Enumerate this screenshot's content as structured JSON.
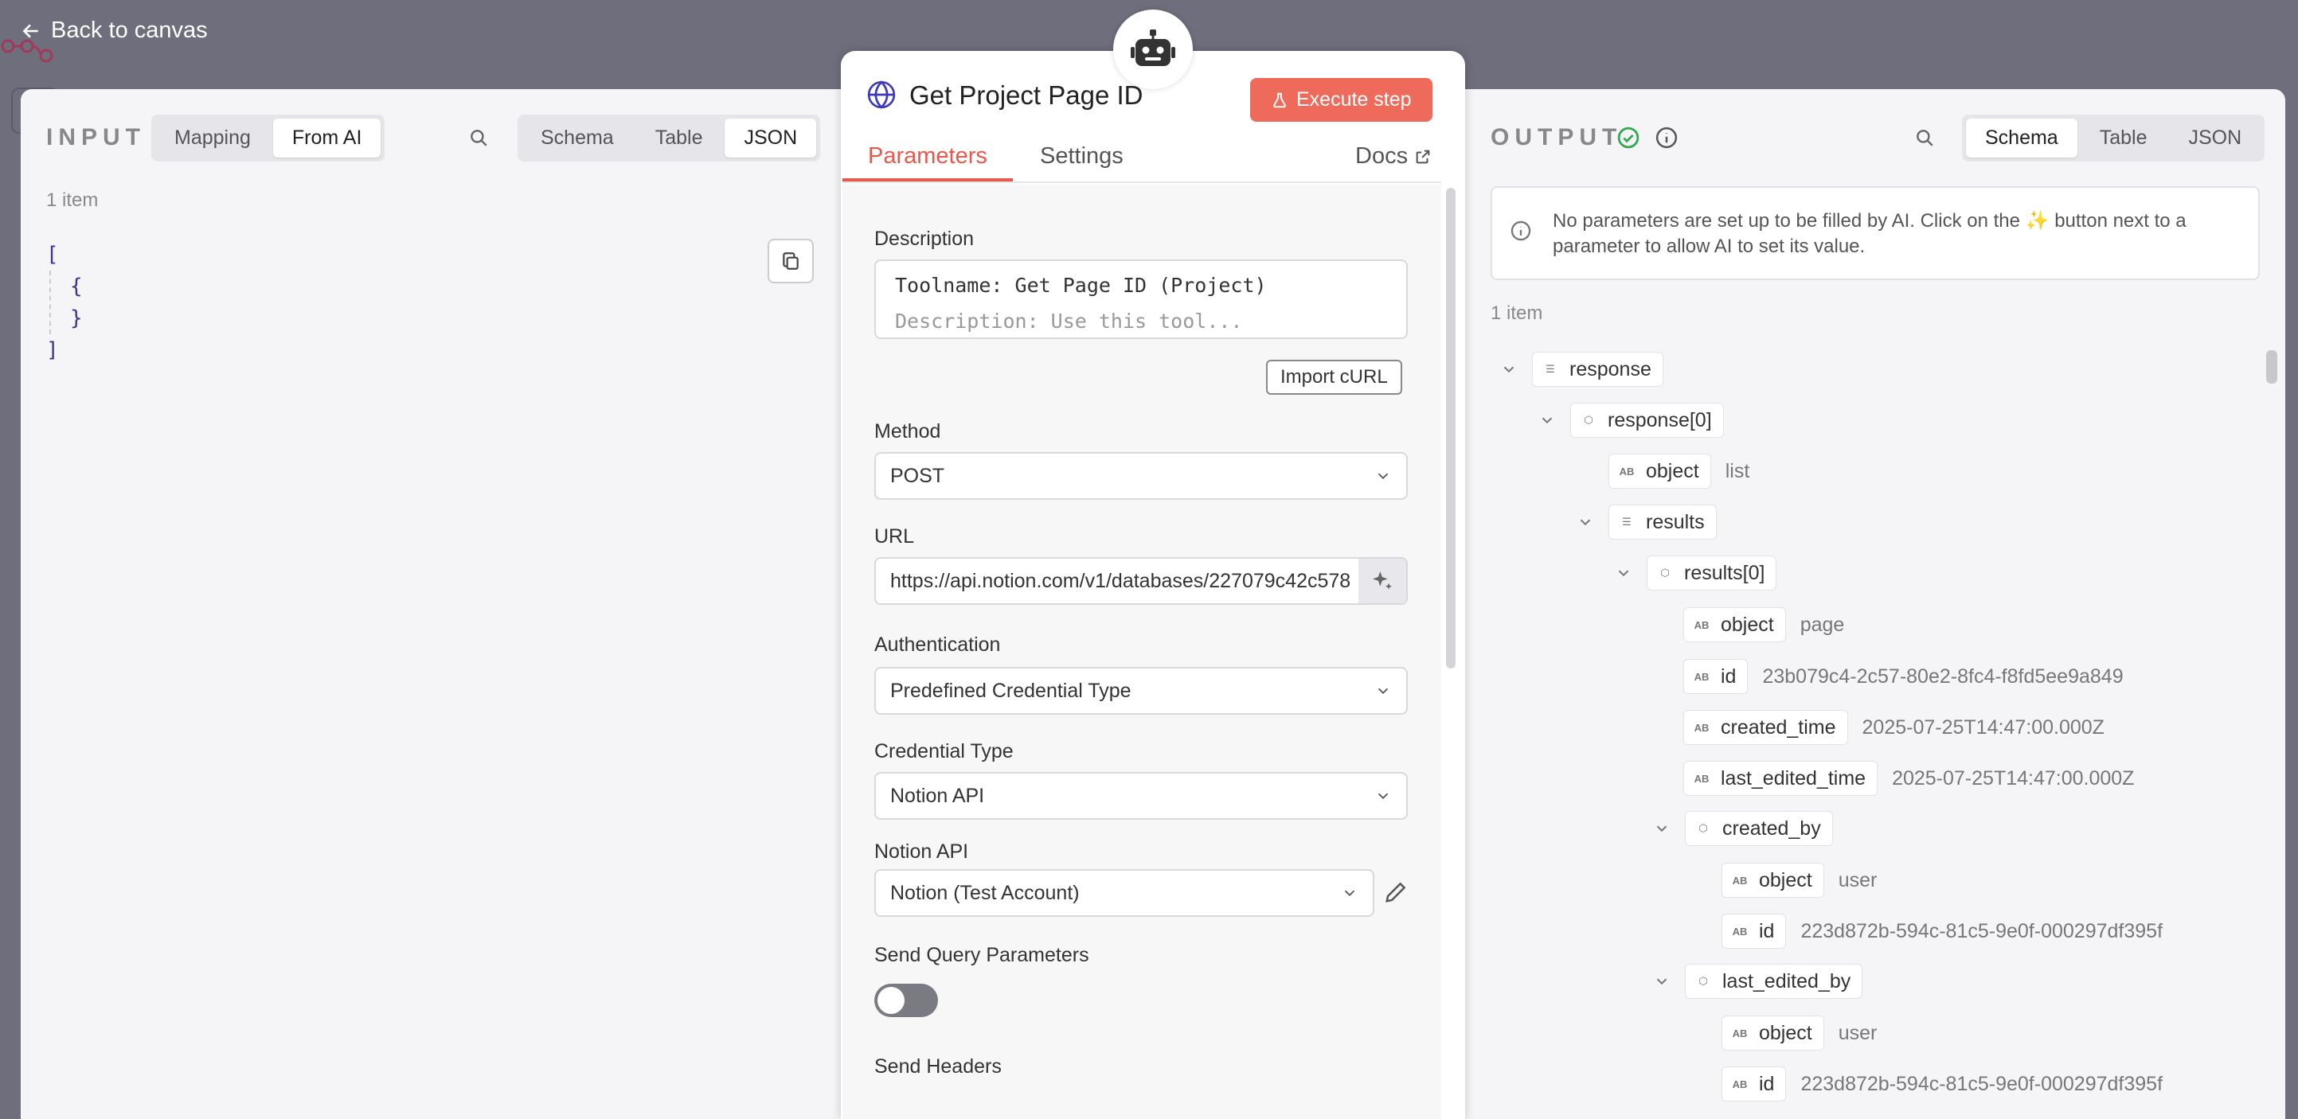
{
  "back_label": "Back to canvas",
  "input": {
    "title": "INPUT",
    "mode_tabs": [
      "Mapping",
      "From AI"
    ],
    "view_tabs": [
      "Schema",
      "Table",
      "JSON"
    ],
    "count": "1 item",
    "json_lines": [
      "[",
      "{",
      "}",
      "]"
    ]
  },
  "node": {
    "title": "Get Project Page ID",
    "execute_label": "Execute step",
    "tabs": [
      "Parameters",
      "Settings"
    ],
    "docs_label": "Docs",
    "description_label": "Description",
    "description_value": "Toolname: Get Page ID (Project)",
    "description_line2": "Description: Use this tool...",
    "import_curl": "Import cURL",
    "method_label": "Method",
    "method_value": "POST",
    "url_label": "URL",
    "url_value": "https://api.notion.com/v1/databases/227079c42c578",
    "auth_label": "Authentication",
    "auth_value": "Predefined Credential Type",
    "cred_type_label": "Credential Type",
    "cred_type_value": "Notion API",
    "notion_api_label": "Notion API",
    "notion_api_value": "Notion (Test Account)",
    "send_query_label": "Send Query Parameters",
    "send_headers_label": "Send Headers"
  },
  "output": {
    "title": "OUTPUT",
    "view_tabs": [
      "Schema",
      "Table",
      "JSON"
    ],
    "notice_line1": "No parameters are set up to be filled by AI. Click on the ✨ button next to a",
    "notice_line2": "parameter to allow AI to set its value.",
    "count": "1 item",
    "tree": [
      {
        "key": "response",
        "type": "list",
        "value": ""
      },
      {
        "key": "response[0]",
        "type": "object",
        "value": ""
      },
      {
        "key": "object",
        "type": "string",
        "value": "list"
      },
      {
        "key": "results",
        "type": "list",
        "value": ""
      },
      {
        "key": "results[0]",
        "type": "object",
        "value": ""
      },
      {
        "key": "object",
        "type": "string",
        "value": "page"
      },
      {
        "key": "id",
        "type": "string",
        "value": "23b079c4-2c57-80e2-8fc4-f8fd5ee9a849"
      },
      {
        "key": "created_time",
        "type": "string",
        "value": "2025-07-25T14:47:00.000Z"
      },
      {
        "key": "last_edited_time",
        "type": "string",
        "value": "2025-07-25T14:47:00.000Z"
      },
      {
        "key": "created_by",
        "type": "object",
        "value": ""
      },
      {
        "key": "object",
        "type": "string",
        "value": "user"
      },
      {
        "key": "id",
        "type": "string",
        "value": "223d872b-594c-81c5-9e0f-000297df395f"
      },
      {
        "key": "last_edited_by",
        "type": "object",
        "value": ""
      },
      {
        "key": "object",
        "type": "string",
        "value": "user"
      },
      {
        "key": "id",
        "type": "string",
        "value": "223d872b-594c-81c5-9e0f-000297df395f"
      }
    ]
  },
  "colors": {
    "accent": "#e8584b",
    "execute": "#ee6a5a",
    "success": "#2fa84f"
  }
}
